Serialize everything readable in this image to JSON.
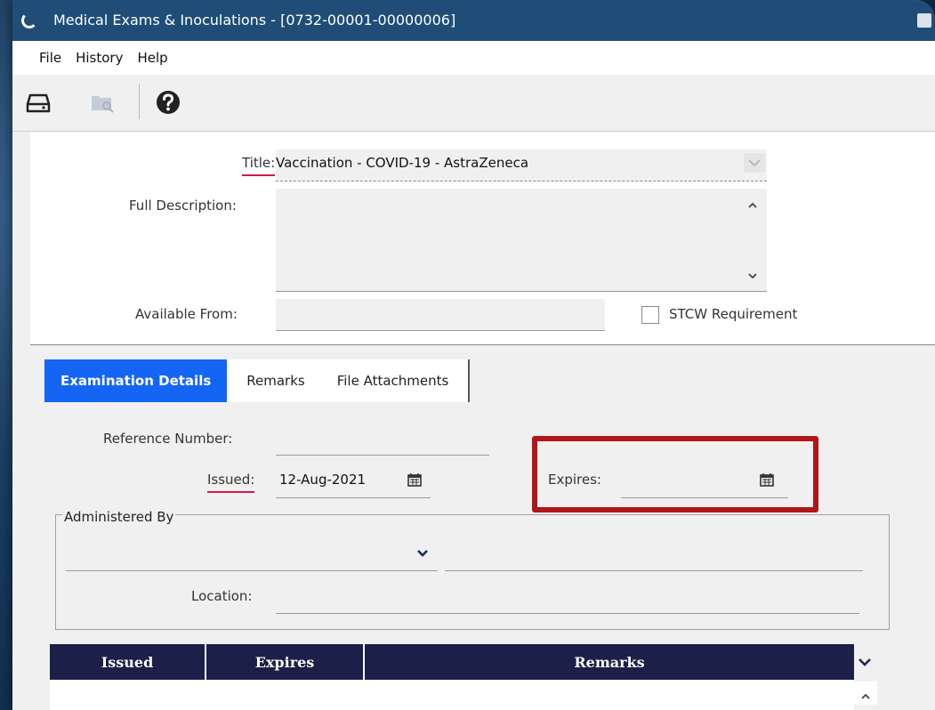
{
  "window": {
    "title": "Medical Exams & Inoculations - [0732-00001-00000006]"
  },
  "menu": {
    "file": "File",
    "history": "History",
    "help": "Help"
  },
  "toolbar": {
    "icons": [
      "save-icon",
      "browse-folder-icon",
      "help-icon"
    ]
  },
  "form": {
    "title_label": "Title:",
    "title_value": "Vaccination - COVID-19 - AstraZeneca",
    "full_description_label": "Full Description:",
    "full_description_value": "",
    "available_from_label": "Available From:",
    "available_from_value": "",
    "stcw_label": "STCW Requirement",
    "stcw_checked": false
  },
  "tabs": [
    {
      "label": "Examination Details",
      "active": true
    },
    {
      "label": "Remarks",
      "active": false
    },
    {
      "label": "File Attachments",
      "active": false
    }
  ],
  "details": {
    "reference_label": "Reference Number:",
    "reference_value": "",
    "issued_label": "Issued:",
    "issued_value": "12-Aug-2021",
    "expires_label": "Expires:",
    "expires_value": "",
    "administered_by_label": "Administered By",
    "administered_by_value": "",
    "administered_by_name": "",
    "location_label": "Location:",
    "location_value": ""
  },
  "grid": {
    "columns": [
      "Issued",
      "Expires",
      "Remarks"
    ]
  },
  "colors": {
    "accent": "#1565f5",
    "highlight": "#b0151a",
    "grid_header": "#1c1f48",
    "required": "#d01c4a"
  }
}
